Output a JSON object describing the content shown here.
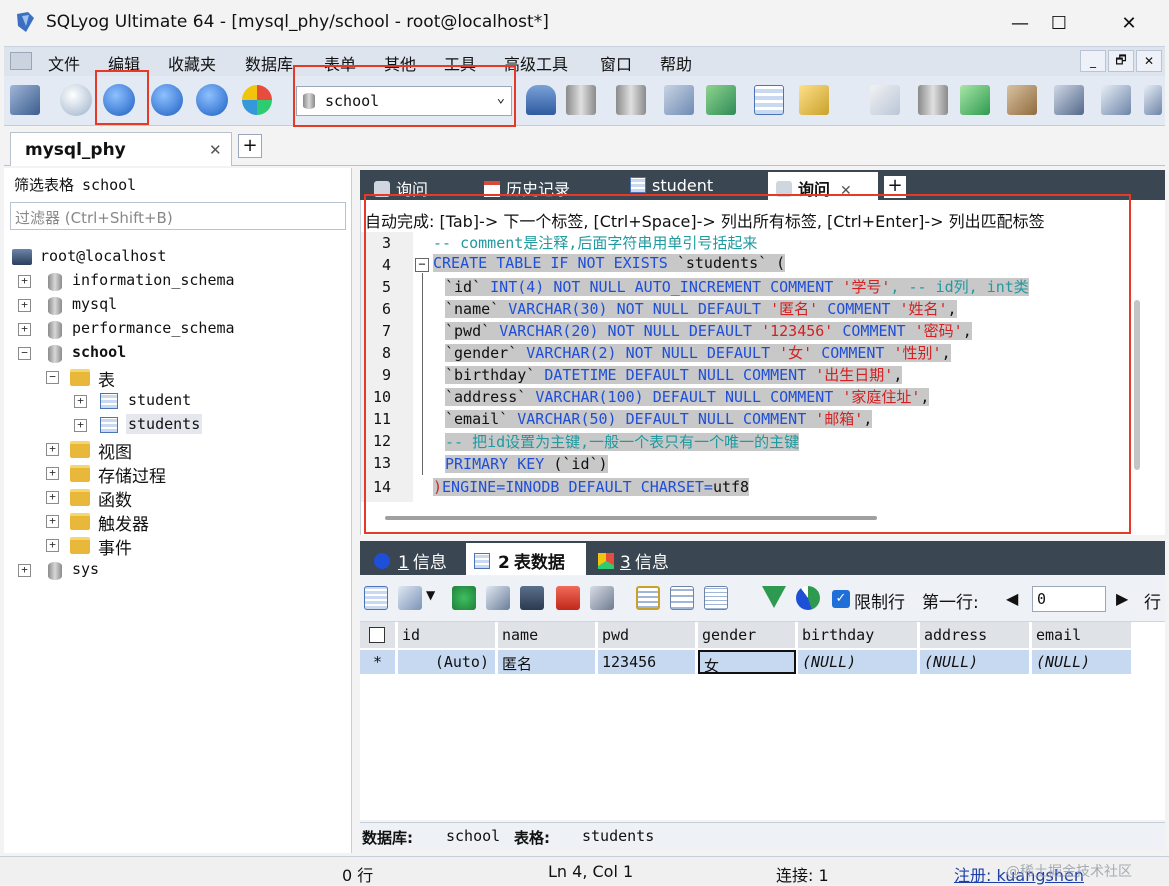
{
  "window": {
    "title": "SQLyog Ultimate 64 - [mysql_phy/school - root@localhost*]",
    "minimize": "—",
    "maximize": "☐",
    "close": "✕"
  },
  "menu": {
    "items": [
      "文件",
      "编辑",
      "收藏夹",
      "数据库",
      "表单",
      "其他",
      "工具",
      "高级工具",
      "窗口",
      "帮助"
    ],
    "mdi_buttons": [
      "_",
      "🗗",
      "✕"
    ]
  },
  "toolbar": {
    "database_selector": "school"
  },
  "connection_tab": {
    "label": "mysql_phy",
    "close": "✕",
    "add": "+"
  },
  "object_browser": {
    "filter_label": "筛选表格",
    "filter_value": "school",
    "filter_placeholder": "过滤器 (Ctrl+Shift+B)",
    "server": "root@localhost",
    "databases": [
      {
        "name": "information_schema",
        "expand": "+"
      },
      {
        "name": "mysql",
        "expand": "+"
      },
      {
        "name": "performance_schema",
        "expand": "+"
      },
      {
        "name": "school",
        "expand": "−"
      },
      {
        "name": "sys",
        "expand": "+"
      }
    ],
    "school_children": {
      "tables_folder": "表",
      "tables": [
        "student",
        "students"
      ],
      "folders": [
        "视图",
        "存储过程",
        "函数",
        "触发器",
        "事件"
      ]
    }
  },
  "editor_tabs": [
    "询问",
    "历史记录",
    "student",
    "询问"
  ],
  "editor": {
    "autocomplete_hint": "自动完成:  [Tab]-> 下一个标签,  [Ctrl+Space]-> 列出所有标签,  [Ctrl+Enter]-> 列出匹配标签",
    "line_numbers": [
      "3",
      "4",
      "5",
      "6",
      "7",
      "8",
      "9",
      "10",
      "11",
      "12",
      "13",
      "14"
    ],
    "line3": "-- comment是注释,后面字符串用单引号括起来",
    "line4_kw": "CREATE TABLE IF NOT EXISTS",
    "line4_id": " `students` (",
    "line5_id": "`id` ",
    "line5_kw": "INT(4) NOT NULL AUTO_INCREMENT COMMENT ",
    "line5_str": "'学号'",
    "line5_rest": ", -- id列, int类",
    "line6_id": "`name` ",
    "line6_kw": "VARCHAR(30) NOT NULL DEFAULT ",
    "line6_str": "'匿名'",
    "line6_kw2": " COMMENT ",
    "line6_str2": "'姓名'",
    "line6_end": ",",
    "line7_id": "`pwd` ",
    "line7_kw": "VARCHAR(20) NOT NULL DEFAULT ",
    "line7_str": "'123456'",
    "line7_kw2": " COMMENT ",
    "line7_str2": "'密码'",
    "line7_end": ",",
    "line8_id": "`gender` ",
    "line8_kw": "VARCHAR(2) NOT NULL DEFAULT ",
    "line8_str": "'女'",
    "line8_kw2": " COMMENT ",
    "line8_str2": "'性别'",
    "line8_end": ",",
    "line9_id": "`birthday` ",
    "line9_kw": "DATETIME DEFAULT NULL COMMENT ",
    "line9_str": "'出生日期'",
    "line9_end": ",",
    "line10_id": "`address` ",
    "line10_kw": "VARCHAR(100) DEFAULT NULL COMMENT ",
    "line10_str": "'家庭住址'",
    "line10_end": ",",
    "line11_id": "`email` ",
    "line11_kw": "VARCHAR(50) DEFAULT NULL COMMENT ",
    "line11_str": "'邮箱'",
    "line11_end": ",",
    "line12": "-- 把id设置为主键,一般一个表只有一个唯一的主键",
    "line13_kw": "PRIMARY KEY ",
    "line13_id": "(`id`)",
    "line14_id": ")",
    "line14_kw": "ENGINE=INNODB DEFAULT CHARSET=",
    "line14_end": "utf8"
  },
  "result_tabs": [
    {
      "num": "1",
      "label": "信息"
    },
    {
      "num": "2",
      "label": "表数据"
    },
    {
      "num": "3",
      "label": "信息"
    }
  ],
  "result_toolbar": {
    "limit_label": "限制行",
    "first_row_label": "第一行:",
    "first_row_value": "0",
    "next_label": "行"
  },
  "grid": {
    "headers": [
      "id",
      "name",
      "pwd",
      "gender",
      "birthday",
      "address",
      "email"
    ],
    "row_marker": "*",
    "row": [
      "(Auto)",
      "匿名",
      "123456",
      "女",
      "(NULL)",
      "(NULL)",
      "(NULL)"
    ]
  },
  "db_info": {
    "db_label": "数据库:",
    "db_value": "school",
    "table_label": "表格:",
    "table_value": "students"
  },
  "status": {
    "rows": "0 行",
    "position": "Ln 4, Col 1",
    "connections": "连接: 1",
    "register": "注册: kuangshen",
    "watermark": "@稀土掘金技术社区"
  },
  "colors": {
    "highlight_box": "#e53a25",
    "keyword": "#1f4fd8",
    "string": "#d42020",
    "comment": "#1f9aa0",
    "tab_bar": "#3a4652"
  }
}
